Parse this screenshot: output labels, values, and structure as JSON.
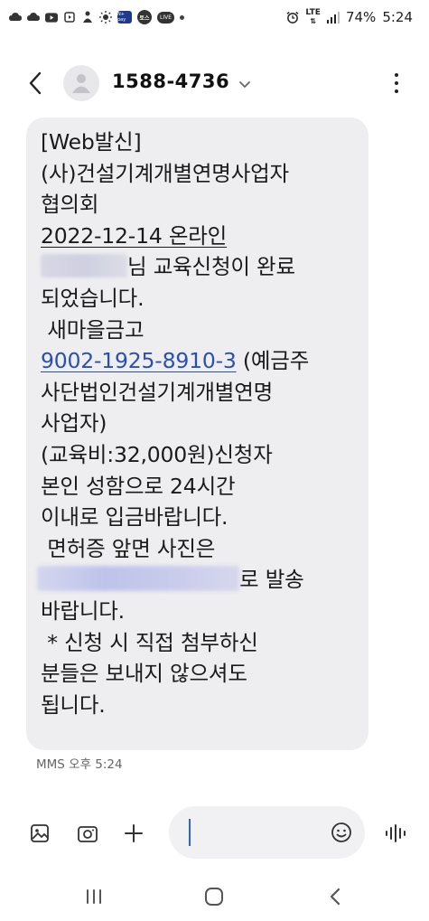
{
  "status_bar": {
    "badges": [
      "N+ pay",
      "토스",
      "LIVE"
    ],
    "network": "LTE",
    "battery": "74%",
    "time": "5:24"
  },
  "header": {
    "contact": "1588-4736"
  },
  "message": {
    "lines": [
      "[Web발신]",
      "(사)건설기계개별연명사업자",
      "협의회",
      "2022-12-14 온라인",
      "님 교육신청이 완료",
      "되었습니다.",
      " 새마을금고",
      "9002-1925-8910-3",
      " (예금주",
      "사단법인건설기계개별연명",
      "사업자)",
      "(교육비:32,000원)신청자",
      "본인 성함으로 24시간",
      "이내로 입금바랍니다.",
      " 면허증 앞면 사진은",
      "로 발송",
      "바랍니다.",
      " * 신청 시 직접 첨부하신",
      "분들은 보내지 않으셔도",
      "됩니다."
    ],
    "meta": "MMS 오후 5:24"
  },
  "colors": {
    "bubble": "#eeeef0",
    "link": "#2a4fb3",
    "caret": "#2b63d9"
  }
}
